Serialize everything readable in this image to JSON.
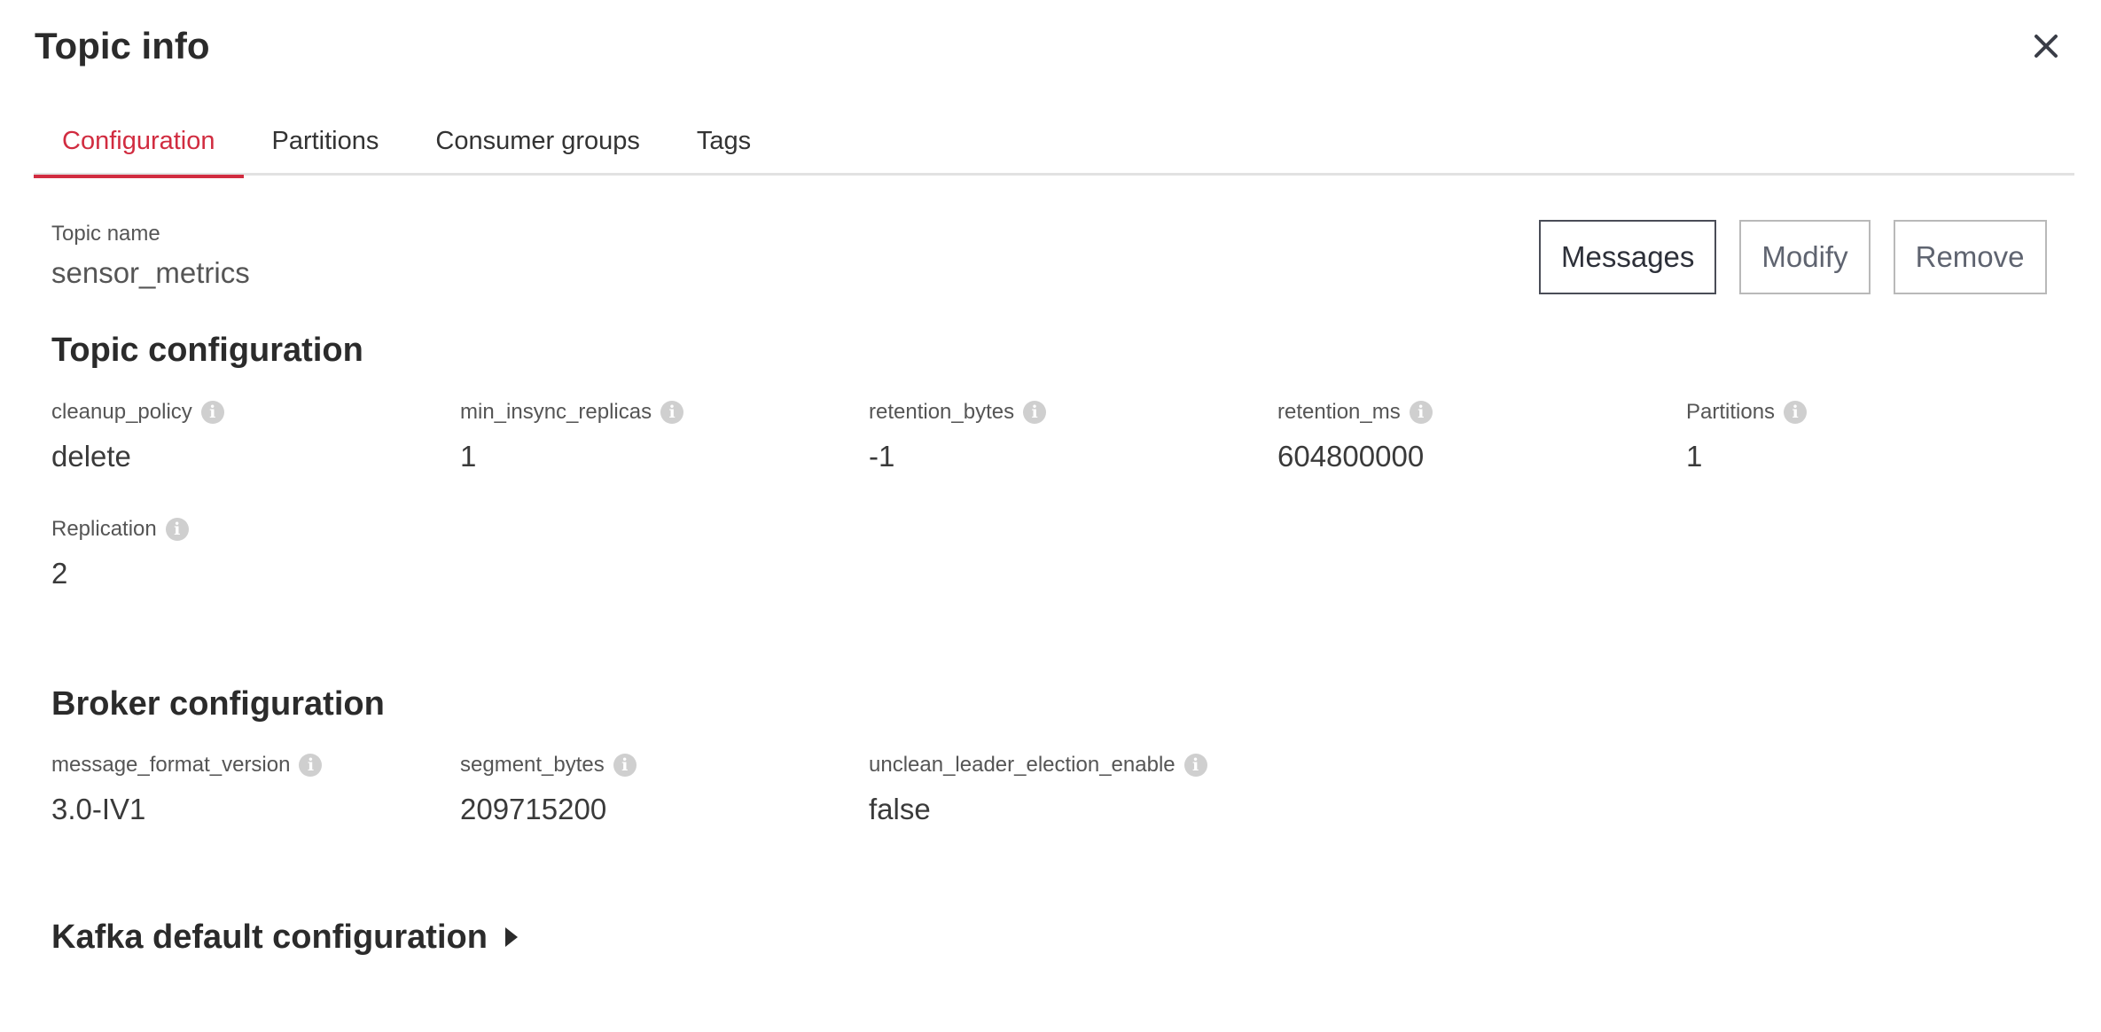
{
  "panel": {
    "title": "Topic info",
    "close_icon": "close-icon"
  },
  "tabs": [
    {
      "label": "Configuration",
      "active": true
    },
    {
      "label": "Partitions",
      "active": false
    },
    {
      "label": "Consumer groups",
      "active": false
    },
    {
      "label": "Tags",
      "active": false
    }
  ],
  "topic": {
    "name_label": "Topic name",
    "name_value": "sensor_metrics"
  },
  "actions": {
    "messages_label": "Messages",
    "modify_label": "Modify",
    "remove_label": "Remove"
  },
  "topic_configuration": {
    "title": "Topic configuration",
    "items": [
      {
        "label": "cleanup_policy",
        "value": "delete",
        "icon": "info-icon"
      },
      {
        "label": "min_insync_replicas",
        "value": "1",
        "icon": "info-icon"
      },
      {
        "label": "retention_bytes",
        "value": "-1",
        "icon": "info-icon"
      },
      {
        "label": "retention_ms",
        "value": "604800000",
        "icon": "info-icon"
      },
      {
        "label": "Partitions",
        "value": "1",
        "icon": "info-icon"
      },
      {
        "label": "Replication",
        "value": "2",
        "icon": "info-icon"
      }
    ]
  },
  "broker_configuration": {
    "title": "Broker configuration",
    "items": [
      {
        "label": "message_format_version",
        "value": "3.0-IV1",
        "icon": "info-icon"
      },
      {
        "label": "segment_bytes",
        "value": "209715200",
        "icon": "info-icon"
      },
      {
        "label": "unclean_leader_election_enable",
        "value": "false",
        "icon": "info-icon"
      }
    ]
  },
  "kafka_default": {
    "title": "Kafka default configuration",
    "icon": "caret-right-icon",
    "expanded": false
  },
  "colors": {
    "accent": "#d12c40",
    "text": "#2b2b2b",
    "muted": "#555555",
    "border": "#b9b9b9",
    "info_icon": "#cfcfcf"
  }
}
